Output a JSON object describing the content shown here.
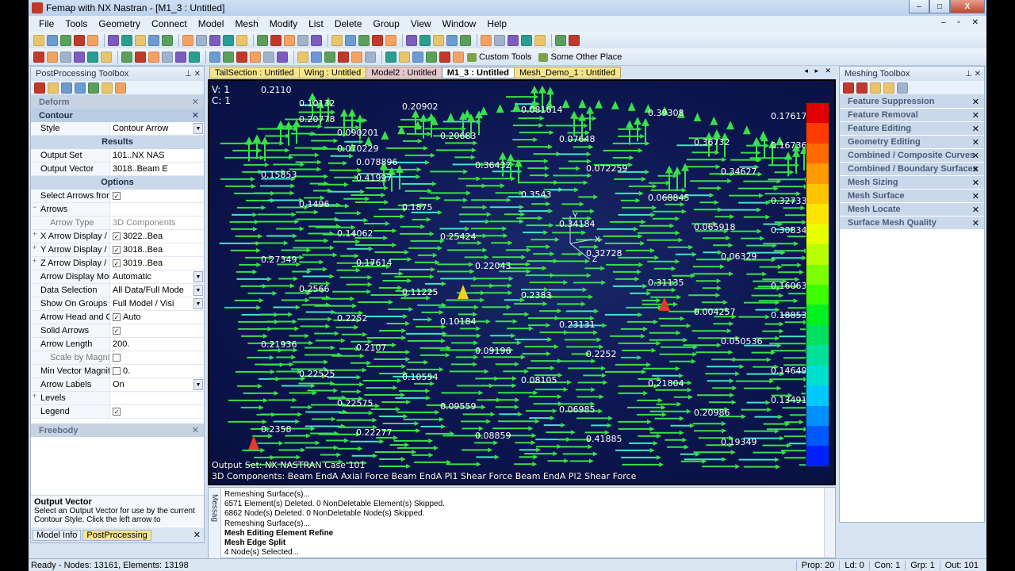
{
  "window": {
    "title": "Femap with NX Nastran - [M1_3 : Untitled]",
    "minimize": "–",
    "maximize": "□",
    "close": "X"
  },
  "menu": [
    "File",
    "Tools",
    "Geometry",
    "Connect",
    "Model",
    "Mesh",
    "Modify",
    "List",
    "Delete",
    "Group",
    "View",
    "Window",
    "Help"
  ],
  "toolbar": {
    "custom_tools": "Custom Tools",
    "some_other_place": "Some Other Place"
  },
  "postprocessing": {
    "title": "PostProcessing Toolbox",
    "deform": "Deform",
    "contour": "Contour",
    "results_header": "Results",
    "options_header": "Options",
    "freebody": "Freebody",
    "rows": [
      {
        "k": "Style",
        "v": "Contour Arrow",
        "dd": true
      },
      {
        "k": "Output Set",
        "v": "101..NX NAS",
        "dd": false
      },
      {
        "k": "Output Vector",
        "v": "3018..Beam E",
        "dd": false
      }
    ],
    "option_rows": [
      {
        "k": "Select Arrows from C",
        "v": "",
        "check": true
      },
      {
        "k": "Arrows",
        "v": "",
        "expand": "−"
      },
      {
        "k": "Arrow Type",
        "v": "3D Components",
        "ind": true,
        "dim": true
      },
      {
        "k": "X Arrow Display / ",
        "v": "3022..Bea",
        "check": true,
        "expand": "+"
      },
      {
        "k": "Y Arrow Display / ",
        "v": "3018..Bea",
        "check": true,
        "expand": "+"
      },
      {
        "k": "Z Arrow Display / ",
        "v": "3019..Bea",
        "check": true,
        "expand": "+"
      },
      {
        "k": "Arrow Display Mode",
        "v": "Automatic",
        "dd": true
      },
      {
        "k": "Data Selection",
        "v": "All Data/Full Mode",
        "dd": true
      },
      {
        "k": "Show On Groups",
        "v": "Full Model / Visi",
        "dd": true
      },
      {
        "k": "Arrow Head and Col",
        "v": "Auto",
        "check": true
      },
      {
        "k": "Solid Arrows",
        "v": "",
        "check": true
      },
      {
        "k": "Arrow Length",
        "v": "200.",
        "dd": false
      },
      {
        "k": "Scale by Magnitud",
        "v": "",
        "check": false,
        "ind": true
      },
      {
        "k": "Min Vector Magnitu",
        "v": "0.",
        "check": false
      },
      {
        "k": "Arrow Labels",
        "v": "On",
        "dd": true
      },
      {
        "k": "Levels",
        "v": "",
        "expand": "+"
      },
      {
        "k": "Legend",
        "v": "",
        "check": true
      }
    ],
    "help_title": "Output Vector",
    "help_text": "Select an Output Vector for use by the current Contour Style. Click the left arrow to",
    "tab_model_info": "Model Info",
    "tab_postprocessing": "PostProcessing"
  },
  "tabs": [
    "TailSection : Untitled",
    "Wing : Untitled",
    "Model2 : Untitled",
    "M1_3 : Untitled",
    "Mesh_Demo_1 : Untitled"
  ],
  "viewport": {
    "v_label": "V: 1",
    "c_label": "C: 1",
    "output_set_line": "Output Set: NX NASTRAN Case 101",
    "vector_line": "3D Components: Beam EndA Axial Force   Beam EndA Pl1 Shear Force   Beam EndA Pl2 Shear Force",
    "axes": {
      "x": "X",
      "y": "Y",
      "z": "Z"
    },
    "sample_values": [
      "0.2110",
      "0.20778",
      "0.070229",
      "0.41997",
      "0.1875",
      "0.25424",
      "0.22043",
      "0.2383",
      "0.23131",
      "0.2252",
      "0.21804",
      "0.20986",
      "0.19349",
      "0.17617",
      "0.16736",
      "0.15853",
      "0.1496",
      "0.14062",
      "0.17614",
      "0.11225",
      "0.10184",
      "0.09196",
      "0.08105",
      "0.06985",
      "0.41885",
      "0.39308",
      "0.36732",
      "0.34627",
      "0.32733",
      "0.30834",
      "0.27349",
      "0.2566",
      "0.2252",
      "0.2107",
      "0.10554",
      "0.09559",
      "0.08859",
      "0.081614",
      "0.07648",
      "0.072259",
      "0.068845",
      "0.065918",
      "0.06329",
      "0.16063",
      "0.18853",
      "0.21936",
      "0.22525",
      "0.22575",
      "0.22277",
      "0.20902",
      "0.20683",
      "0.36432",
      "0.3543",
      "0.34184",
      "0.32728",
      "0.31135",
      "0.004257",
      "0.050536",
      "0.14649",
      "0.13491",
      "0.2358",
      "0.10132",
      "0.090201",
      "0.078896"
    ]
  },
  "legend_colors": [
    "#e00000",
    "#ff3a00",
    "#ff6a00",
    "#ff9a00",
    "#ffc400",
    "#ffe600",
    "#e8ff00",
    "#b8ff00",
    "#7cff00",
    "#3dff00",
    "#00f020",
    "#00e060",
    "#00e09a",
    "#00e0d0",
    "#00c8ff",
    "#0090ff",
    "#0058ff",
    "#0020ff"
  ],
  "messages": {
    "tab": "Messag",
    "lines": [
      {
        "t": "Remeshing Surface(s)...",
        "b": false
      },
      {
        "t": "6571 Element(s) Deleted. 0 NonDeletable Element(s) Skipped.",
        "b": false
      },
      {
        "t": "6862 Node(s) Deleted. 0 NonDeletable Node(s) Skipped.",
        "b": false
      },
      {
        "t": "Remeshing Surface(s)...",
        "b": false
      },
      {
        "t": "Mesh Editing Element Refine",
        "b": true
      },
      {
        "t": "Mesh Edge Split",
        "b": true
      },
      {
        "t": "4 Node(s) Selected...",
        "b": false
      }
    ]
  },
  "meshing": {
    "title": "Meshing Toolbox",
    "items": [
      "Feature Suppression",
      "Feature Removal",
      "Feature Editing",
      "Geometry Editing",
      "Combined / Composite Curves",
      "Combined / Boundary Surfaces",
      "Mesh Sizing",
      "Mesh Surface",
      "Mesh Locate",
      "Surface Mesh Quality"
    ]
  },
  "status": {
    "left": "Ready - Nodes: 13161,  Elements: 13198",
    "prop": "Prop: 20",
    "ld": "Ld: 0",
    "con": "Con: 1",
    "grp": "Grp: 1",
    "out": "Out: 101"
  }
}
